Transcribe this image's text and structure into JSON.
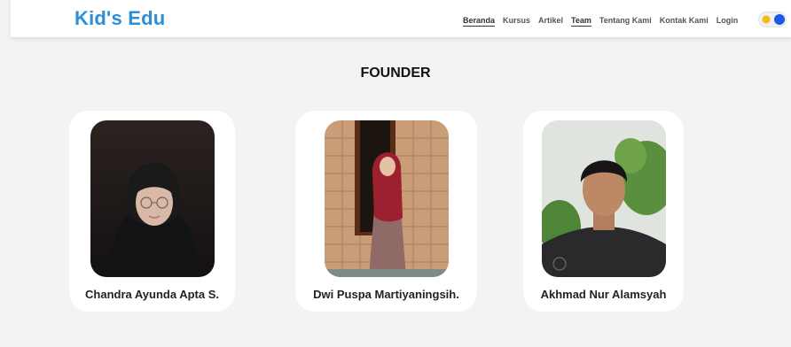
{
  "brand": "Kid's Edu",
  "nav": {
    "items": [
      {
        "label": "Beranda",
        "active": true
      },
      {
        "label": "Kursus",
        "active": false
      },
      {
        "label": "Artikel",
        "active": false
      },
      {
        "label": "Team",
        "active": true
      },
      {
        "label": "Tentang Kami",
        "active": false
      },
      {
        "label": "Kontak Kami",
        "active": false
      },
      {
        "label": "Login",
        "active": false
      }
    ]
  },
  "section": {
    "title": "FOUNDER"
  },
  "founders": [
    {
      "name": "Chandra Ayunda Apta S."
    },
    {
      "name": "Dwi Puspa Martiyaningsih."
    },
    {
      "name": "Akhmad Nur Alamsyah"
    }
  ],
  "colors": {
    "brand": "#2a8fd6",
    "toggle_knob": "#1f57e6",
    "sun": "#f5b81c"
  }
}
